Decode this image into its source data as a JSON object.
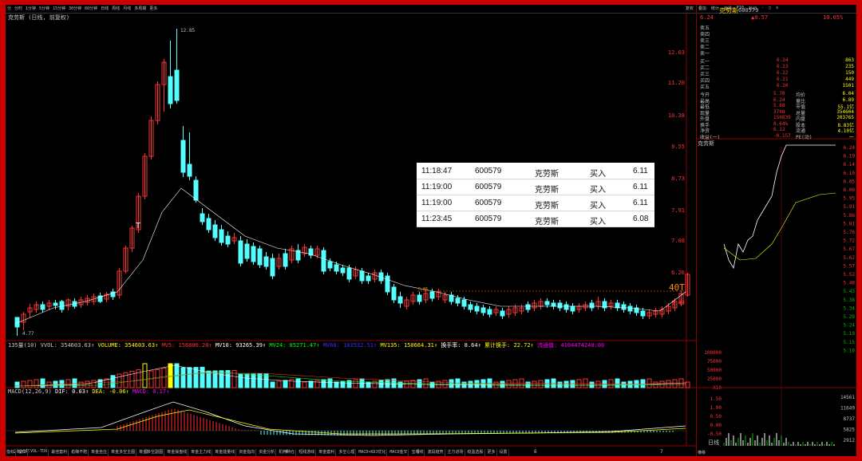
{
  "toolbar": {
    "timeframes": [
      "分",
      "分时",
      "1分钟",
      "5分钟",
      "15分钟",
      "30分钟",
      "60分钟",
      "日线",
      "周线",
      "月线",
      "多周期",
      "更多"
    ],
    "right_tools": [
      "复权",
      "叠加",
      "统计",
      "画线",
      "F10",
      "标记",
      "-",
      "□",
      "≡"
    ]
  },
  "chart": {
    "title": "克劳斯 (日线, 前复权)",
    "high_label": "12.85",
    "low_label": "4.77",
    "mid_label": "5.86",
    "mark_40t": "40T",
    "t_label": "T",
    "y_axis": [
      "12.03",
      "11.20",
      "10.38",
      "9.55",
      "8.73",
      "7.91",
      "7.08",
      "6.26",
      "5.43"
    ],
    "colors": {
      "up": "#ff3232",
      "down": "#54ffff",
      "ma": "#ffffff",
      "price_line": "#ff8c00"
    }
  },
  "volume": {
    "title": "135量(10)",
    "vvol": "VVOL: 354603.63↑",
    "volume": "VOLUME: 354603.63↑",
    "mv5": "MV5: 156806.20↑",
    "mv10": "MV10: 93265.39↑",
    "mv24": "MV24: 85271.47↑",
    "mv60": "MV60: 103532.51↑",
    "mv135": "MV135: 150664.31↑",
    "turnover": "换手率: 8.64↑",
    "cum_turnover": "累计换手: 22.72↑",
    "amount": "流通值: 4104474240.00",
    "y_axis": [
      "100000",
      "75000",
      "50000",
      "25000",
      "X10"
    ]
  },
  "macd": {
    "title": "MACD(12,26,9)",
    "dif": "DIF: 0.03↑",
    "dea": "DEA: -0.06↑",
    "macd": "MACD: 0.17↑",
    "y_axis": [
      "1.50",
      "1.00",
      "0.50",
      "0.00",
      "-0.50"
    ]
  },
  "x_axis": {
    "labels": [
      "2020年",
      "3",
      "4",
      "5",
      "6",
      "7"
    ]
  },
  "bottom_tabs": [
    "指标",
    "窗口",
    "VOL-TDX",
    "最佳套利",
    "稳赚不赔",
    "筹金坐庄",
    "筹金多空主图",
    "筹金多空副图",
    "筹金操盘线",
    "筹金主力线",
    "筹金能量线",
    "资金指向",
    "资金分析",
    "机构持仓",
    "短线游戏",
    "筹金套利",
    "多空心理",
    "MACD+KDJ优化",
    "MACD金叉",
    "宝塔线",
    "波段趋势",
    "主力进场",
    "稳盈选股",
    "更多",
    "设置"
  ],
  "quote": {
    "name": "克劳斯",
    "code": "600579",
    "price": "6.24",
    "change": "▲0.57",
    "pct": "10.05%",
    "sell_levels": [
      {
        "label": "卖五",
        "price": "",
        "vol": ""
      },
      {
        "label": "卖四",
        "price": "",
        "vol": ""
      },
      {
        "label": "卖三",
        "price": "",
        "vol": ""
      },
      {
        "label": "卖二",
        "price": "",
        "vol": ""
      },
      {
        "label": "卖一",
        "price": "",
        "vol": ""
      }
    ],
    "buy_levels": [
      {
        "label": "买一",
        "price": "6.24",
        "vol": "863"
      },
      {
        "label": "买二",
        "price": "6.23",
        "vol": "235"
      },
      {
        "label": "买三",
        "price": "6.22",
        "vol": "150"
      },
      {
        "label": "买四",
        "price": "6.21",
        "vol": "449"
      },
      {
        "label": "买五",
        "price": "6.20",
        "vol": "1501"
      }
    ],
    "stats": [
      {
        "a": "今开",
        "b": "5.70",
        "c": "均价",
        "d": "6.04"
      },
      {
        "a": "最高",
        "b": "6.24",
        "c": "量比",
        "d": "6.89"
      },
      {
        "a": "最低",
        "b": "5.68",
        "c": "市值",
        "d": "55.1亿"
      },
      {
        "a": "现量",
        "b": "3798",
        "c": "总量",
        "d": "354604"
      },
      {
        "a": "外盘",
        "b": "150839",
        "c": "内盘",
        "d": "203765"
      },
      {
        "a": "换手",
        "b": "8.64%",
        "c": "股本",
        "d": "8.83亿"
      },
      {
        "a": "净资",
        "b": "6.12",
        "c": "流通",
        "d": "4.10亿"
      },
      {
        "a": "收益(一)",
        "b": "-0.157",
        "c": "PE(动)",
        "d": "一"
      }
    ],
    "intraday_title": "克劳斯",
    "intraday_axis": [
      "6.24",
      "6.19",
      "6.14",
      "6.10",
      "6.05",
      "6.00",
      "5.95",
      "5.91",
      "5.86",
      "5.81",
      "5.76",
      "5.72",
      "5.67",
      "5.62",
      "5.57",
      "5.52",
      "5.48",
      "5.43",
      "5.38",
      "5.34",
      "5.29",
      "5.24",
      "5.19",
      "5.15",
      "5.10"
    ],
    "intraday_vol_axis": [
      "14561",
      "11649",
      "8737",
      "5825",
      "2912"
    ],
    "intraday_tab": "日线",
    "bottom_right": "横移"
  },
  "ticks": [
    {
      "time": "11:18:47",
      "code": "600579",
      "name": "克劳斯",
      "side": "买入",
      "price": "6.11"
    },
    {
      "time": "11:19:00",
      "code": "600579",
      "name": "克劳斯",
      "side": "买入",
      "price": "6.11"
    },
    {
      "time": "11:19:00",
      "code": "600579",
      "name": "克劳斯",
      "side": "买入",
      "price": "6.11"
    },
    {
      "time": "11:23:45",
      "code": "600579",
      "name": "克劳斯",
      "side": "买入",
      "price": "6.08"
    }
  ]
}
